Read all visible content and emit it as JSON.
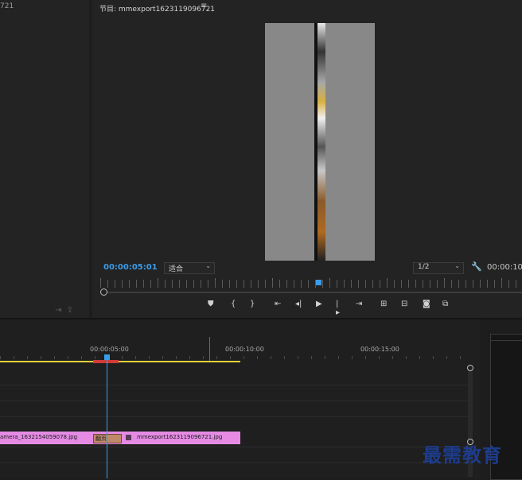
{
  "left_panel": {
    "title_fragment": "721"
  },
  "program_monitor": {
    "title": "节目: mmexport1623119096721",
    "menu_icon": "hamburger-menu-icon",
    "timecode": "00:00:05:01",
    "fit_label": "适合",
    "resolution_label": "1/2",
    "timecode_right": "00:00:10:",
    "accent_color": "#3b9ce8"
  },
  "transport": {
    "icons": [
      "add-marker-icon",
      "mark-in-icon",
      "mark-out-icon",
      "go-to-in-icon",
      "step-back-icon",
      "play-icon",
      "step-forward-icon",
      "go-to-out-icon",
      "lift-icon",
      "extract-icon",
      "export-frame-icon",
      "comparison-view-icon"
    ]
  },
  "timeline": {
    "times": [
      "00:00:05:00",
      "00:00:10:00",
      "00:00:15:00"
    ],
    "clips": {
      "first": "amera_1632154059078.jpg",
      "transition": "翻页",
      "second": "mmexport1623119096721.jpg"
    },
    "clip_color": "#e58be4",
    "work_area_color": "#e4d23a"
  },
  "watermark": "最需教育"
}
